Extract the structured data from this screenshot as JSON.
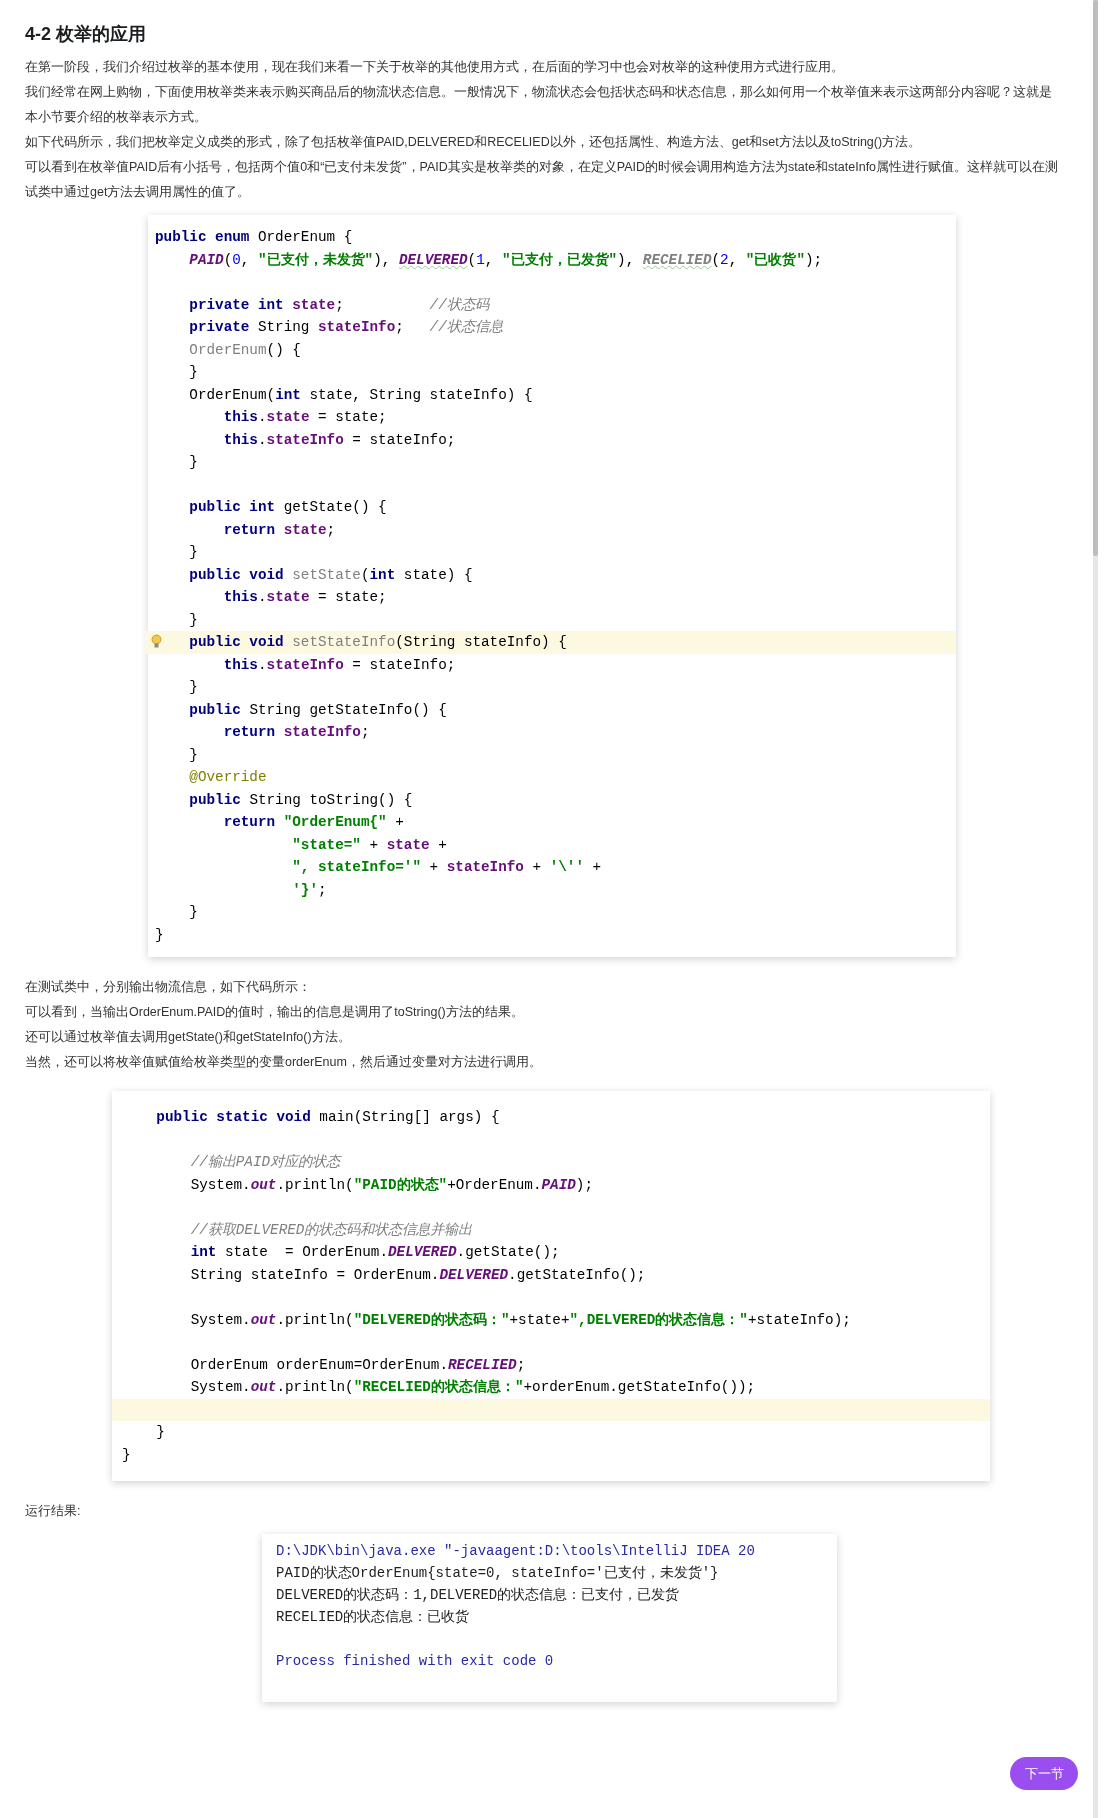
{
  "title": "4-2 枚举的应用",
  "intro_paragraphs": [
    "在第一阶段，我们介绍过枚举的基本使用，现在我们来看一下关于枚举的其他使用方式，在后面的学习中也会对枚举的这种使用方式进行应用。",
    "我们经常在网上购物，下面使用枚举类来表示购买商品后的物流状态信息。一般情况下，物流状态会包括状态码和状态信息，那么如何用一个枚举值来表示这两部分内容呢？这就是本小节要介绍的枚举表示方式。",
    "如下代码所示，我们把枚举定义成类的形式，除了包括枚举值PAID,DELVERED和RECELIED以外，还包括属性、构造方法、get和set方法以及toString()方法。",
    "可以看到在枚举值PAID后有小括号，包括两个值0和“已支付未发货”，PAID其实是枚举类的对象，在定义PAID的时候会调用构造方法为state和stateInfo属性进行赋值。这样就可以在测试类中通过get方法去调用属性的值了。"
  ],
  "enum_code": {
    "lines": [
      {
        "kind": "code",
        "tokens": [
          {
            "kind": "kw",
            "text": "public enum"
          },
          {
            "kind": "plain",
            "text": " OrderEnum {"
          }
        ]
      },
      {
        "kind": "code",
        "tokens": [
          {
            "kind": "enum",
            "text": "    PAID"
          },
          {
            "kind": "plain",
            "text": "("
          },
          {
            "kind": "num",
            "text": "0"
          },
          {
            "kind": "plain",
            "text": ", "
          },
          {
            "kind": "str",
            "text": "\"已支付，未发货\""
          },
          {
            "kind": "plain",
            "text": "), "
          },
          {
            "kind": "enum",
            "text": "DELVERED",
            "typo": true
          },
          {
            "kind": "plain",
            "text": "("
          },
          {
            "kind": "num",
            "text": "1"
          },
          {
            "kind": "plain",
            "text": ", "
          },
          {
            "kind": "str",
            "text": "\"已支付，已发货\""
          },
          {
            "kind": "plain",
            "text": "), "
          },
          {
            "kind": "unused",
            "text": "RECELIED",
            "typo": true
          },
          {
            "kind": "plain",
            "text": "("
          },
          {
            "kind": "num",
            "text": "2"
          },
          {
            "kind": "plain",
            "text": ", "
          },
          {
            "kind": "str",
            "text": "\"已收货\""
          },
          {
            "kind": "plain",
            "text": ");"
          }
        ]
      },
      {
        "kind": "blank"
      },
      {
        "kind": "code",
        "tokens": [
          {
            "kind": "kw",
            "text": "    private int "
          },
          {
            "kind": "field",
            "text": "state"
          },
          {
            "kind": "plain",
            "text": ";          "
          },
          {
            "kind": "cmt",
            "text": "//状态码"
          }
        ]
      },
      {
        "kind": "code",
        "tokens": [
          {
            "kind": "kw",
            "text": "    private"
          },
          {
            "kind": "plain",
            "text": " String "
          },
          {
            "kind": "field",
            "text": "stateInfo"
          },
          {
            "kind": "plain",
            "text": ";   "
          },
          {
            "kind": "cmt",
            "text": "//状态信息"
          }
        ]
      },
      {
        "kind": "code",
        "tokens": [
          {
            "kind": "dim",
            "text": "    OrderEnum"
          },
          {
            "kind": "plain",
            "text": "() {"
          }
        ]
      },
      {
        "kind": "code",
        "tokens": [
          {
            "kind": "plain",
            "text": "    }"
          }
        ]
      },
      {
        "kind": "code",
        "tokens": [
          {
            "kind": "plain",
            "text": "    OrderEnum("
          },
          {
            "kind": "kw",
            "text": "int"
          },
          {
            "kind": "plain",
            "text": " state, String stateInfo) {"
          }
        ]
      },
      {
        "kind": "code",
        "tokens": [
          {
            "kind": "kw",
            "text": "        this"
          },
          {
            "kind": "plain",
            "text": "."
          },
          {
            "kind": "field",
            "text": "state"
          },
          {
            "kind": "plain",
            "text": " = state;"
          }
        ]
      },
      {
        "kind": "code",
        "tokens": [
          {
            "kind": "kw",
            "text": "        this"
          },
          {
            "kind": "plain",
            "text": "."
          },
          {
            "kind": "field",
            "text": "stateInfo"
          },
          {
            "kind": "plain",
            "text": " = stateInfo;"
          }
        ]
      },
      {
        "kind": "code",
        "tokens": [
          {
            "kind": "plain",
            "text": "    }"
          }
        ]
      },
      {
        "kind": "blank"
      },
      {
        "kind": "code",
        "tokens": [
          {
            "kind": "kw",
            "text": "    public int"
          },
          {
            "kind": "plain",
            "text": " getState() {"
          }
        ]
      },
      {
        "kind": "code",
        "tokens": [
          {
            "kind": "kw",
            "text": "        return "
          },
          {
            "kind": "field",
            "text": "state"
          },
          {
            "kind": "plain",
            "text": ";"
          }
        ]
      },
      {
        "kind": "code",
        "tokens": [
          {
            "kind": "plain",
            "text": "    }"
          }
        ]
      },
      {
        "kind": "code",
        "tokens": [
          {
            "kind": "kw",
            "text": "    public void "
          },
          {
            "kind": "dim",
            "text": "setState"
          },
          {
            "kind": "plain",
            "text": "("
          },
          {
            "kind": "kw",
            "text": "int"
          },
          {
            "kind": "plain",
            "text": " state) {"
          }
        ]
      },
      {
        "kind": "code",
        "tokens": [
          {
            "kind": "kw",
            "text": "        this"
          },
          {
            "kind": "plain",
            "text": "."
          },
          {
            "kind": "field",
            "text": "state"
          },
          {
            "kind": "plain",
            "text": " = state;"
          }
        ]
      },
      {
        "kind": "code",
        "tokens": [
          {
            "kind": "plain",
            "text": "    }"
          }
        ]
      },
      {
        "kind": "code",
        "highlighted": true,
        "lightbulb": true,
        "tokens": [
          {
            "kind": "kw",
            "text": "    public void "
          },
          {
            "kind": "dim",
            "text": "setStateInfo"
          },
          {
            "kind": "plain",
            "text": "(String stateInfo) {"
          }
        ]
      },
      {
        "kind": "code",
        "tokens": [
          {
            "kind": "kw",
            "text": "        this"
          },
          {
            "kind": "plain",
            "text": "."
          },
          {
            "kind": "field",
            "text": "stateInfo"
          },
          {
            "kind": "plain",
            "text": " = stateInfo;"
          }
        ]
      },
      {
        "kind": "code",
        "tokens": [
          {
            "kind": "plain",
            "text": "    }"
          }
        ]
      },
      {
        "kind": "code",
        "tokens": [
          {
            "kind": "kw",
            "text": "    public"
          },
          {
            "kind": "plain",
            "text": " String getStateInfo() {"
          }
        ]
      },
      {
        "kind": "code",
        "tokens": [
          {
            "kind": "kw",
            "text": "        return "
          },
          {
            "kind": "field",
            "text": "stateInfo"
          },
          {
            "kind": "plain",
            "text": ";"
          }
        ]
      },
      {
        "kind": "code",
        "tokens": [
          {
            "kind": "plain",
            "text": "    }"
          }
        ]
      },
      {
        "kind": "code",
        "tokens": [
          {
            "kind": "ann",
            "text": "    @Override"
          }
        ]
      },
      {
        "kind": "code",
        "tokens": [
          {
            "kind": "kw",
            "text": "    public"
          },
          {
            "kind": "plain",
            "text": " String toString() {"
          }
        ]
      },
      {
        "kind": "code",
        "tokens": [
          {
            "kind": "kw",
            "text": "        return "
          },
          {
            "kind": "str",
            "text": "\"OrderEnum{\""
          },
          {
            "kind": "plain",
            "text": " +"
          }
        ]
      },
      {
        "kind": "code",
        "tokens": [
          {
            "kind": "str",
            "text": "                \"state=\""
          },
          {
            "kind": "plain",
            "text": " + "
          },
          {
            "kind": "field",
            "text": "state"
          },
          {
            "kind": "plain",
            "text": " +"
          }
        ]
      },
      {
        "kind": "code",
        "tokens": [
          {
            "kind": "str",
            "text": "                \", stateInfo='\""
          },
          {
            "kind": "plain",
            "text": " + "
          },
          {
            "kind": "field",
            "text": "stateInfo"
          },
          {
            "kind": "plain",
            "text": " + "
          },
          {
            "kind": "str",
            "text": "'\\''"
          },
          {
            "kind": "plain",
            "text": " +"
          }
        ]
      },
      {
        "kind": "code",
        "tokens": [
          {
            "kind": "str",
            "text": "                '}'"
          },
          {
            "kind": "plain",
            "text": ";"
          }
        ]
      },
      {
        "kind": "code",
        "tokens": [
          {
            "kind": "plain",
            "text": "    }"
          }
        ]
      },
      {
        "kind": "code",
        "tokens": [
          {
            "kind": "plain",
            "text": "}"
          }
        ]
      }
    ]
  },
  "test_paragraphs": [
    "在测试类中，分别输出物流信息，如下代码所示：",
    "可以看到，当输出OrderEnum.PAID的值时，输出的信息是调用了toString()方法的结果。",
    "还可以通过枚举值去调用getState()和getStateInfo()方法。",
    "当然，还可以将枚举值赋值给枚举类型的变量orderEnum，然后通过变量对方法进行调用。"
  ],
  "test_code": {
    "lines": [
      {
        "kind": "code",
        "tokens": [
          {
            "kind": "kw",
            "text": "    public static void"
          },
          {
            "kind": "plain",
            "text": " main(String[] args) {"
          }
        ]
      },
      {
        "kind": "blank"
      },
      {
        "kind": "code",
        "tokens": [
          {
            "kind": "cmt",
            "text": "        //输出PAID对应的状态"
          }
        ]
      },
      {
        "kind": "code",
        "tokens": [
          {
            "kind": "plain",
            "text": "        System."
          },
          {
            "kind": "enum",
            "text": "out"
          },
          {
            "kind": "plain",
            "text": ".println("
          },
          {
            "kind": "str",
            "text": "\"PAID的状态\""
          },
          {
            "kind": "plain",
            "text": "+OrderEnum."
          },
          {
            "kind": "enum",
            "text": "PAID"
          },
          {
            "kind": "plain",
            "text": ");"
          }
        ]
      },
      {
        "kind": "blank"
      },
      {
        "kind": "code",
        "tokens": [
          {
            "kind": "cmt",
            "text": "        //获取DELVERED的状态码和状态信息并输出"
          }
        ]
      },
      {
        "kind": "code",
        "tokens": [
          {
            "kind": "kw",
            "text": "        int"
          },
          {
            "kind": "plain",
            "text": " state  = OrderEnum."
          },
          {
            "kind": "enum",
            "text": "DELVERED"
          },
          {
            "kind": "plain",
            "text": ".getState();"
          }
        ]
      },
      {
        "kind": "code",
        "tokens": [
          {
            "kind": "plain",
            "text": "        String stateInfo = OrderEnum."
          },
          {
            "kind": "enum",
            "text": "DELVERED"
          },
          {
            "kind": "plain",
            "text": ".getStateInfo();"
          }
        ]
      },
      {
        "kind": "blank"
      },
      {
        "kind": "code",
        "tokens": [
          {
            "kind": "plain",
            "text": "        System."
          },
          {
            "kind": "enum",
            "text": "out"
          },
          {
            "kind": "plain",
            "text": ".println("
          },
          {
            "kind": "str",
            "text": "\"DELVERED的状态码：\""
          },
          {
            "kind": "plain",
            "text": "+state+"
          },
          {
            "kind": "str",
            "text": "\",DELVERED的状态信息：\""
          },
          {
            "kind": "plain",
            "text": "+stateInfo);"
          }
        ]
      },
      {
        "kind": "blank"
      },
      {
        "kind": "code",
        "tokens": [
          {
            "kind": "plain",
            "text": "        OrderEnum orderEnum=OrderEnum."
          },
          {
            "kind": "enum",
            "text": "RECELIED"
          },
          {
            "kind": "plain",
            "text": ";"
          }
        ]
      },
      {
        "kind": "code",
        "tokens": [
          {
            "kind": "plain",
            "text": "        System."
          },
          {
            "kind": "enum",
            "text": "out"
          },
          {
            "kind": "plain",
            "text": ".println("
          },
          {
            "kind": "str",
            "text": "\"RECELIED的状态信息：\""
          },
          {
            "kind": "plain",
            "text": "+orderEnum.getStateInfo());"
          }
        ]
      },
      {
        "kind": "blank",
        "highlighted": true
      },
      {
        "kind": "code",
        "tokens": [
          {
            "kind": "plain",
            "text": "    }"
          }
        ]
      },
      {
        "kind": "code",
        "tokens": [
          {
            "kind": "plain",
            "text": "}"
          }
        ]
      }
    ]
  },
  "result_label": "运行结果:",
  "console_output": {
    "lines": [
      {
        "kind": "system",
        "text": "D:\\JDK\\bin\\java.exe \"-javaagent:D:\\tools\\IntelliJ IDEA 20"
      },
      {
        "kind": "out",
        "text": "PAID的状态OrderEnum{state=0, stateInfo='已支付，未发货'}"
      },
      {
        "kind": "out",
        "text": "DELVERED的状态码：1,DELVERED的状态信息：已支付，已发货"
      },
      {
        "kind": "out",
        "text": "RECELIED的状态信息：已收货"
      },
      {
        "kind": "blank"
      },
      {
        "kind": "system",
        "text": "Process finished with exit code 0"
      }
    ]
  },
  "next_button": "下一节"
}
